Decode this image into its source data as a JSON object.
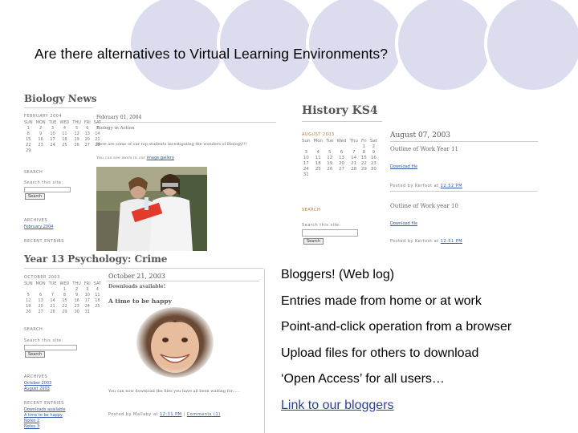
{
  "colors": {
    "circle_fill": "#dcdcef",
    "circle_ring": "#ffffff",
    "link": "#2a3f9e"
  },
  "slide": {
    "title": "Are there alternatives to Virtual Learning Environments?"
  },
  "biology": {
    "blog_title": "Biology News",
    "month": "FEBRUARY 2004",
    "days": [
      "SUN",
      "MON",
      "TUE",
      "WED",
      "THU",
      "FRI",
      "SAT"
    ],
    "cal_rows": [
      [
        "1",
        "2",
        "3",
        "4",
        "5",
        "6",
        "7"
      ],
      [
        "8",
        "9",
        "10",
        "11",
        "12",
        "13",
        "14"
      ],
      [
        "15",
        "16",
        "17",
        "18",
        "19",
        "20",
        "21"
      ],
      [
        "22",
        "23",
        "24",
        "25",
        "26",
        "27",
        "28"
      ],
      [
        "29",
        "",
        "",
        "",
        "",
        "",
        ""
      ]
    ],
    "search_label": "SEARCH",
    "search_caption": "Search this site:",
    "search_button": "Search",
    "archives_label": "ARCHIVES",
    "archive_item": "February 2004",
    "recent_label": "RECENT ENTRIES",
    "post_date": "February 01, 2004",
    "post_title": "Biology in Action",
    "post_text": "Here are some of our top students investigating the wonders of Biology!!!",
    "post_link_text": "image gallery",
    "post_link_prefix": "You can see more in our"
  },
  "history": {
    "blog_title": "History KS4",
    "month": "AUGUST 2003",
    "days": [
      "Sun",
      "Mon",
      "Tue",
      "Wed",
      "Thu",
      "Fri",
      "Sat"
    ],
    "cal_rows": [
      [
        "",
        "",
        "",
        "",
        "",
        "1",
        "2"
      ],
      [
        "3",
        "4",
        "5",
        "6",
        "7",
        "8",
        "9"
      ],
      [
        "10",
        "11",
        "12",
        "13",
        "14",
        "15",
        "16"
      ],
      [
        "17",
        "18",
        "19",
        "20",
        "21",
        "22",
        "23"
      ],
      [
        "24",
        "25",
        "26",
        "27",
        "28",
        "29",
        "30"
      ],
      [
        "31",
        "",
        "",
        "",
        "",
        "",
        ""
      ]
    ],
    "search_label": "SEARCH",
    "search_caption": "Search this site:",
    "search_button": "Search",
    "post_date": "August 07, 2003",
    "post1_title": "Outline of Work Year 11",
    "post1_link": "Download file",
    "post1_footer": "Posted by Kerfoot at",
    "post1_time": "12:52 PM",
    "post2_title": "Outline of Work year 10",
    "post2_link": "Download file",
    "post2_footer": "Posted by Kerfoot at",
    "post2_time": "12:51 PM"
  },
  "psychology": {
    "blog_title": "Year 13 Psychology: Crime",
    "month": "OCTOBER 2003",
    "days": [
      "SUN",
      "MON",
      "TUE",
      "WED",
      "THU",
      "FRI",
      "SAT"
    ],
    "cal_rows": [
      [
        "",
        "",
        "",
        "1",
        "2",
        "3",
        "4"
      ],
      [
        "5",
        "6",
        "7",
        "8",
        "9",
        "10",
        "11"
      ],
      [
        "12",
        "13",
        "14",
        "15",
        "16",
        "17",
        "18"
      ],
      [
        "19",
        "20",
        "21",
        "22",
        "23",
        "24",
        "25"
      ],
      [
        "26",
        "27",
        "28",
        "29",
        "30",
        "31",
        ""
      ]
    ],
    "post_date": "October 21, 2003",
    "post_subtitle": "Downloads available!",
    "post_title": "A time to be happy",
    "search_label": "SEARCH",
    "search_caption": "Search this site:",
    "search_button": "Search",
    "archives_label": "ARCHIVES",
    "archive_items": [
      "October 2003",
      "August 2003"
    ],
    "recent_label": "RECENT ENTRIES",
    "recent_items": [
      "Downloads available",
      "A time to be happy",
      "Notes 2",
      "Notes 3"
    ],
    "post_text": "You can now download the files you have all been waiting for......",
    "post_footer": "Posted by Mallaby at",
    "post_time": "12:31 PM",
    "post_comments": "Comments (1)"
  },
  "bullets": [
    "Bloggers!  (Web log)",
    "Entries made from home or at work",
    "Point-and-click operation from a browser",
    "Upload files for others to download",
    "‘Open Access’ for all users…"
  ],
  "link_bullet": "Link to our bloggers"
}
